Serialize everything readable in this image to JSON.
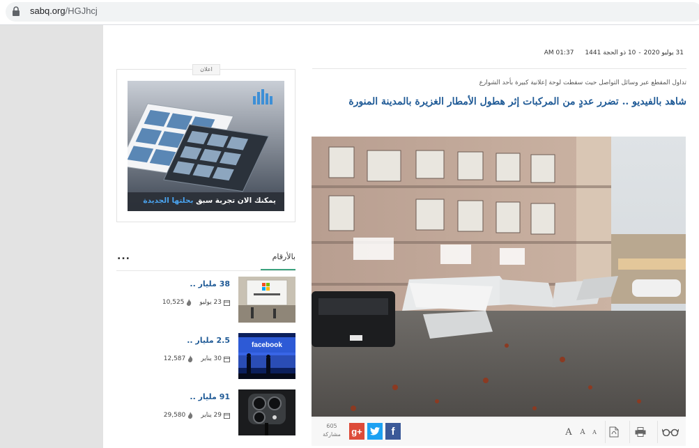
{
  "browser": {
    "domain": "sabq.org",
    "path": "/HGJhcj"
  },
  "article": {
    "date_gregorian": "31 يوليو 2020",
    "date_separator": "-",
    "date_hijri": "10 ذو الحجة 1441",
    "time": "01:37 AM",
    "subtitle": "تداول المقطع عبر وسائل التواصل حيث سقطت لوحة إعلانية كبيرة بأحد الشوارع",
    "title": "شاهد بالفيديو .. تضرر عددٍ من المركبات إثر هطول الأمطار الغزيرة بالمدينة المنورة"
  },
  "toolbar": {
    "font_large": "A",
    "font_medium": "A",
    "font_small": "A",
    "share_count": "605",
    "share_label": "مشاركة"
  },
  "ad": {
    "label": "اعلان",
    "headline_part1": "يمكنك الان تجربة سبق",
    "headline_part2": "بحلتها الجديدة"
  },
  "numbers_section": {
    "title": "بالأرقام",
    "more": "...",
    "items": [
      {
        "title": "38 مليار ..",
        "date": "23 يوليو",
        "views": "10,525"
      },
      {
        "title": "2.5 مليار ..",
        "date": "30 يناير",
        "views": "12,587"
      },
      {
        "title": "91 مليار ..",
        "date": "29 يناير",
        "views": "29,580"
      }
    ]
  },
  "colors": {
    "link_blue": "#1f5a96",
    "accent_green": "#3aa17e",
    "google_red": "#dd4b39",
    "twitter_blue": "#1da1f2",
    "facebook_blue": "#3b5998"
  }
}
